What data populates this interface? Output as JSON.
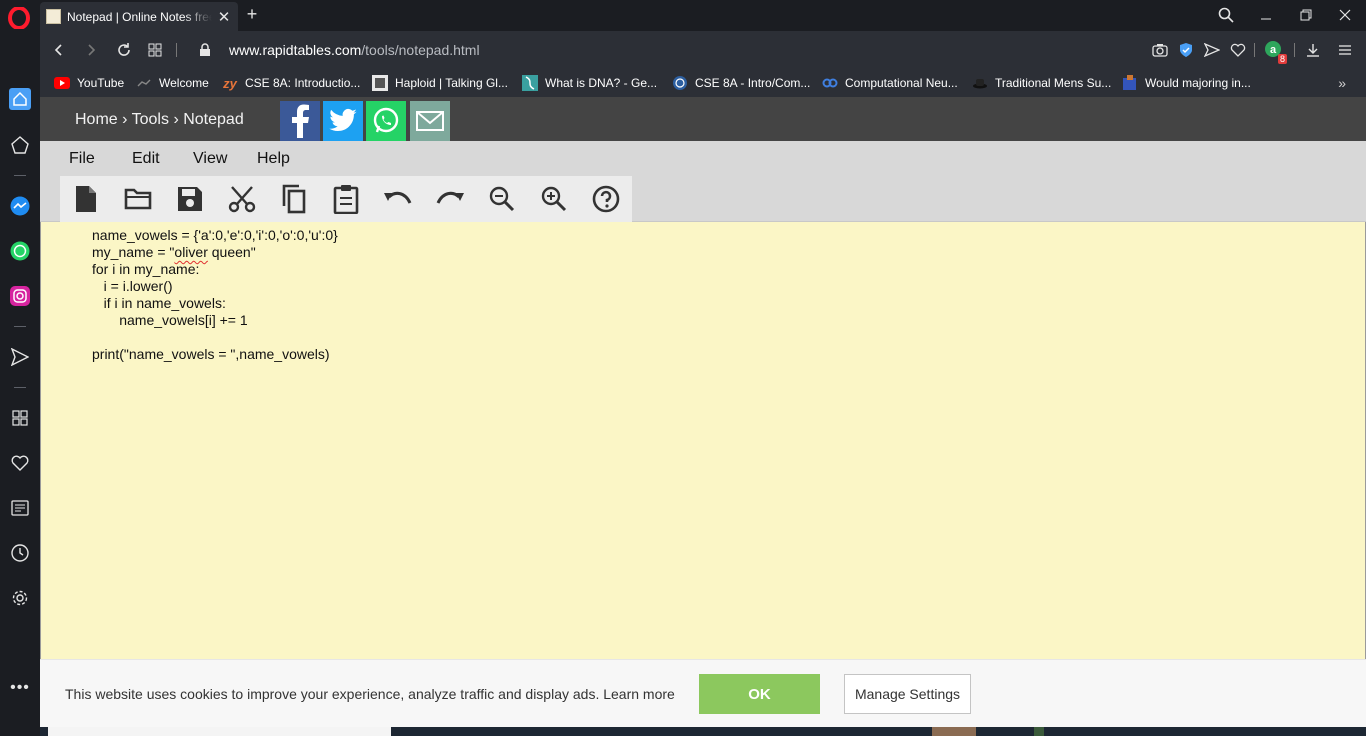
{
  "browser": {
    "tab_title": "Notepad | Online Notes free",
    "url_domain": "www.rapidtables.com",
    "url_path": "/tools/notepad.html",
    "extension_badge": "8",
    "bookmarks": [
      {
        "label": "YouTube",
        "icon": "youtube-icon",
        "color": "#ff0000"
      },
      {
        "label": "Welcome",
        "icon": "welcome-icon",
        "color": "#777777"
      },
      {
        "label": "CSE 8A: Introductio...",
        "icon": "zybooks-icon",
        "color": "#e8753a"
      },
      {
        "label": "Haploid | Talking Gl...",
        "icon": "haploid-icon",
        "color": "#dddddd"
      },
      {
        "label": "What is DNA? - Ge...",
        "icon": "dna-icon",
        "color": "#3aa0a0"
      },
      {
        "label": "CSE 8A - Intro/Com...",
        "icon": "cse-icon",
        "color": "#4a90d9"
      },
      {
        "label": "Computational Neu...",
        "icon": "coursera-icon",
        "color": "#3f7fe0"
      },
      {
        "label": "Traditional Mens Su...",
        "icon": "hat-icon",
        "color": "#333333"
      },
      {
        "label": "Would majoring in...",
        "icon": "quora-icon",
        "color": "#3355bb"
      }
    ],
    "bookmarks_more": "»"
  },
  "site": {
    "breadcrumb": {
      "home": "Home",
      "sep": "›",
      "tools": "Tools",
      "current": "Notepad"
    },
    "share_colors": {
      "facebook": "#3b5998",
      "twitter": "#1da1f2",
      "whatsapp": "#25d366",
      "email": "#7ea99c"
    }
  },
  "menu": {
    "items": [
      "File",
      "Edit",
      "View",
      "Help"
    ]
  },
  "toolbar": {
    "buttons": [
      "new-file",
      "open-folder",
      "save",
      "cut",
      "copy",
      "paste",
      "undo",
      "redo",
      "zoom-out",
      "zoom-in",
      "help"
    ]
  },
  "editor": {
    "lines": [
      "name_vowels = {'a':0,'e':0,'i':0,'o':0,'u':0}",
      "my_name = \"oliver queen\"",
      "for i in my_name:",
      "   i = i.lower()",
      "   if i in name_vowels:",
      "       name_vowels[i] += 1",
      "",
      "print(\"name_vowels = \",name_vowels)"
    ],
    "line2_prefix": "my_name = \"",
    "line2_misspelled": "oliver",
    "line2_suffix": " queen\""
  },
  "cookie_banner": {
    "text": "This website uses cookies to improve your experience, analyze traffic and display ads. Learn more",
    "ok_label": "OK",
    "manage_label": "Manage Settings"
  },
  "colors": {
    "editor_bg": "#fbf6c6",
    "ok_green": "#8cc85e",
    "opera_red": "#ff1b2d"
  }
}
